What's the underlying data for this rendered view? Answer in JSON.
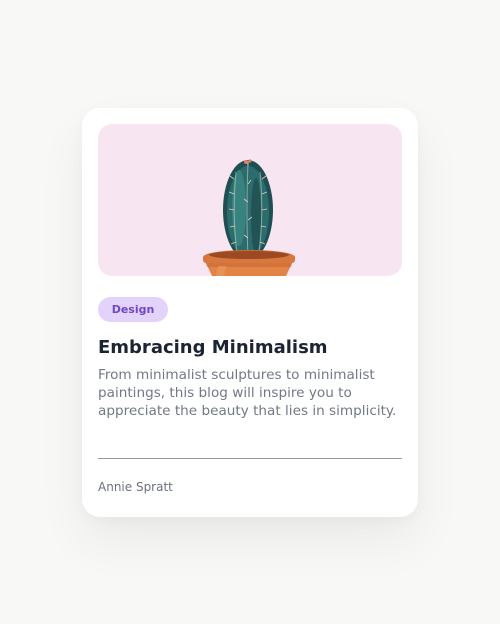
{
  "card": {
    "category": "Design",
    "title": "Embracing Minimalism",
    "description": "From minimalist sculptures to minimalist paintings, this blog will inspire you to appreciate the beauty that lies in simplicity.",
    "author": "Annie Spratt",
    "image_subject": "cactus-in-terracotta-pot-illustration"
  },
  "colors": {
    "page_background": "#f8f8f6",
    "card_background": "#ffffff",
    "image_background": "#f7e6f1",
    "badge_background": "#e3d3fb",
    "badge_text": "#7048c4",
    "title_text": "#1c2434",
    "body_text": "#727887",
    "divider": "#9a9a9a"
  }
}
